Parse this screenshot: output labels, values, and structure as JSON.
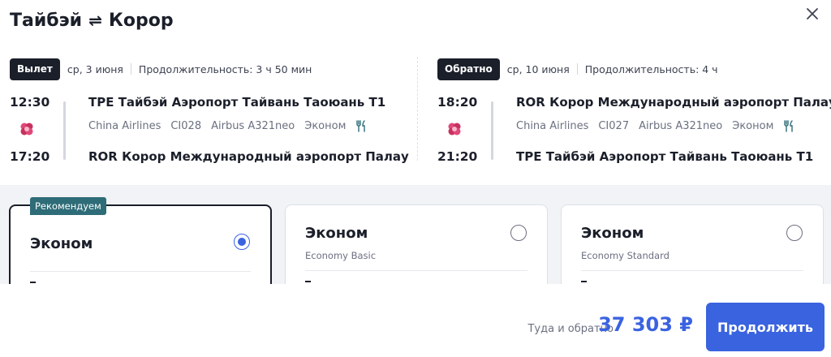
{
  "header": {
    "from": "Тайбэй",
    "swap_icon": "⇌",
    "to": "Корор"
  },
  "close_icon": "close-icon",
  "legs": [
    {
      "badge": "Вылет",
      "date": "ср, 3 июня",
      "duration": "Продолжительность: 3 ч 50 мин",
      "dep_time": "12:30",
      "arr_time": "17:20",
      "dep_airport": "TPE Тайбэй Аэропорт Тайвань Таоюань Т1",
      "arr_airport": "ROR Корор Международный аэропорт Палау",
      "airline": "China Airlines",
      "flight_no": "CI028",
      "aircraft": "Airbus A321neo",
      "cabin": "Эконом",
      "meal_icon": "meal-icon",
      "airline_logo": "china-airlines-logo"
    },
    {
      "badge": "Обратно",
      "date": "ср, 10 июня",
      "duration": "Продолжительность: 4 ч",
      "dep_time": "18:20",
      "arr_time": "21:20",
      "dep_airport": "ROR Корор Международный аэропорт Палау",
      "arr_airport": "TPE Тайбэй Аэропорт Тайвань Таоюань Т1",
      "airline": "China Airlines",
      "flight_no": "CI027",
      "aircraft": "Airbus A321neo",
      "cabin": "Эконом",
      "meal_icon": "meal-icon",
      "airline_logo": "china-airlines-logo"
    }
  ],
  "tariffs": [
    {
      "badge": "Рекомендуем",
      "name": "Эконом",
      "subtitle": "",
      "selected": true,
      "dash": "–"
    },
    {
      "badge": "",
      "name": "Эконом",
      "subtitle": "Economy Basic",
      "selected": false,
      "dash": "–"
    },
    {
      "badge": "",
      "name": "Эконом",
      "subtitle": "Economy Standard",
      "selected": false,
      "dash": "–"
    }
  ],
  "footer": {
    "total_label": "Туда и обратно",
    "total_price": "37 303 ₽",
    "continue_label": "Продолжить"
  },
  "colors": {
    "accent": "#3a63e0",
    "dark": "#1b1f2a",
    "recommend_badge": "#2e6c78",
    "band": "#f1f3f6"
  }
}
